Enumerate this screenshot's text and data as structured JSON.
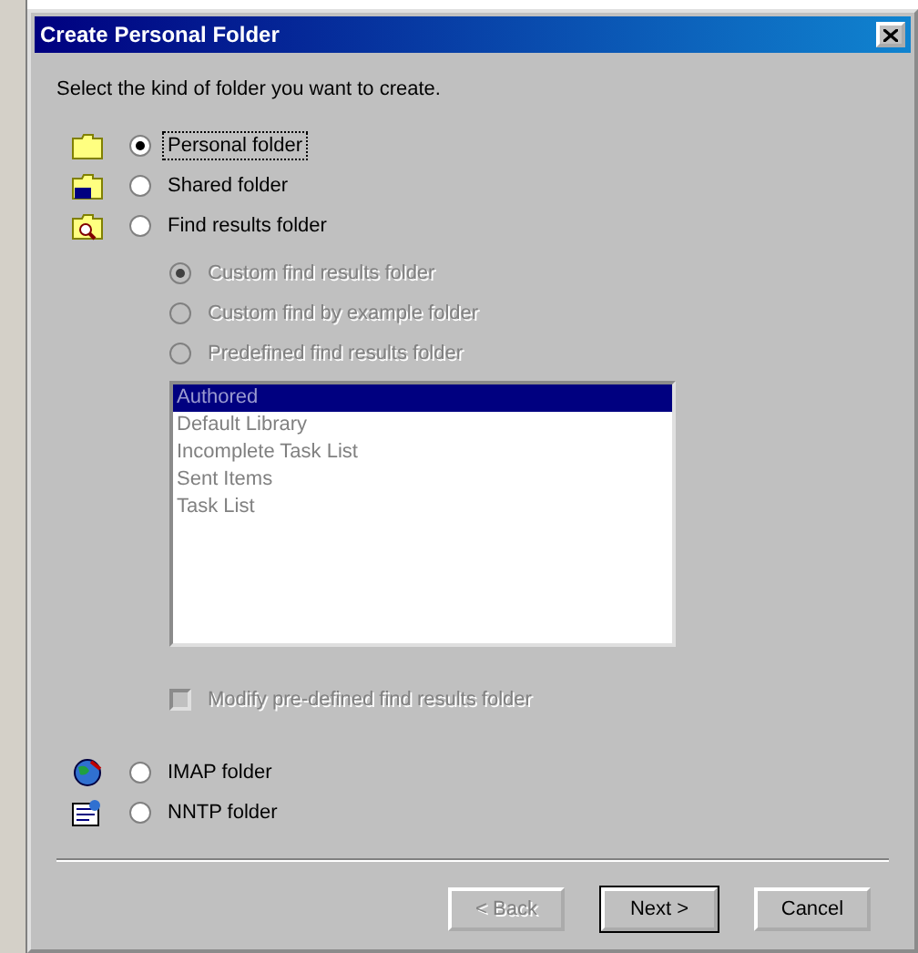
{
  "window": {
    "title": "Create Personal Folder"
  },
  "instruction": "Select the kind of folder you want to create.",
  "folder_types": [
    {
      "label": "Personal folder",
      "kind": "personal",
      "selected": true,
      "focused": true
    },
    {
      "label": "Shared folder",
      "kind": "shared",
      "selected": false,
      "focused": false
    },
    {
      "label": "Find results folder",
      "kind": "find",
      "selected": false,
      "focused": false
    }
  ],
  "find_options": [
    {
      "label": "Custom find results folder",
      "selected": true,
      "disabled": true
    },
    {
      "label": "Custom find by example folder",
      "selected": false,
      "disabled": true
    },
    {
      "label": "Predefined find results folder",
      "selected": false,
      "disabled": true
    }
  ],
  "predefined_list": {
    "disabled": true,
    "items": [
      {
        "label": "Authored",
        "selected": true
      },
      {
        "label": "Default Library",
        "selected": false
      },
      {
        "label": "Incomplete Task List",
        "selected": false
      },
      {
        "label": "Sent Items",
        "selected": false
      },
      {
        "label": "Task List",
        "selected": false
      }
    ]
  },
  "modify_option": {
    "label": "Modify pre-defined find results folder",
    "checked": false,
    "disabled": true
  },
  "server_folder_types": [
    {
      "label": "IMAP folder",
      "kind": "imap",
      "selected": false,
      "focused": false
    },
    {
      "label": "NNTP folder",
      "kind": "nntp",
      "selected": false,
      "focused": false
    }
  ],
  "buttons": [
    {
      "label": "< Back",
      "disabled": true,
      "default": false
    },
    {
      "label": "Next >",
      "disabled": false,
      "default": true
    },
    {
      "label": "Cancel",
      "disabled": false,
      "default": false
    }
  ]
}
